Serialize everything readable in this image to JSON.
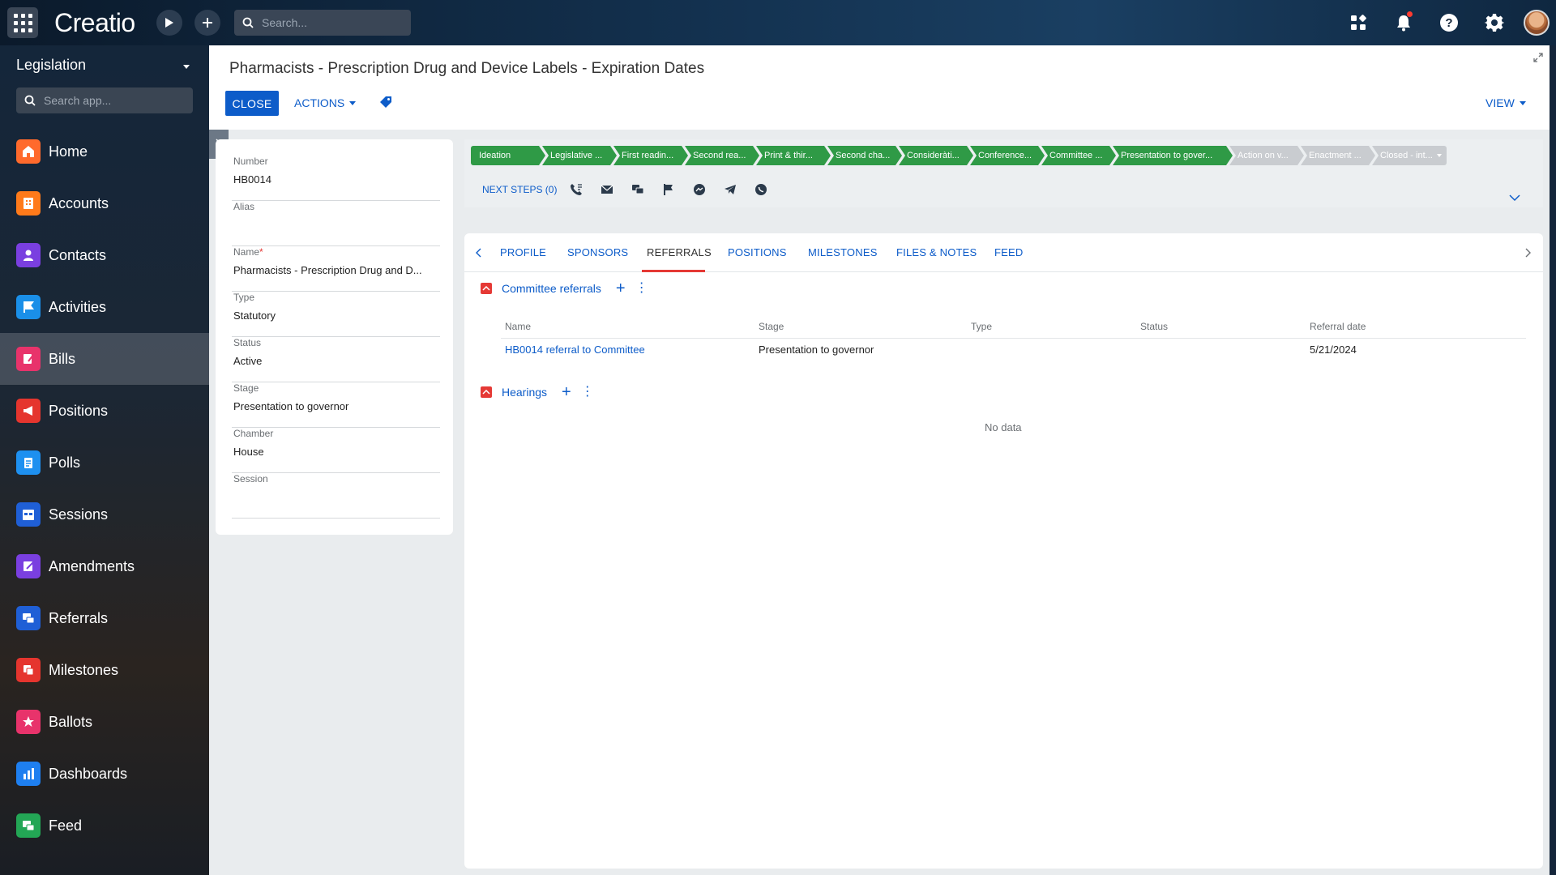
{
  "topbar": {
    "logo": "Creatio",
    "search_placeholder": "Search..."
  },
  "sidebar": {
    "title": "Legislation",
    "search_placeholder": "Search app...",
    "items": [
      {
        "label": "Home",
        "color": "#ff6a2c"
      },
      {
        "label": "Accounts",
        "color": "#ff7a1a"
      },
      {
        "label": "Contacts",
        "color": "#7a3fe0"
      },
      {
        "label": "Activities",
        "color": "#1a8fe8"
      },
      {
        "label": "Bills",
        "color": "#e8336b"
      },
      {
        "label": "Positions",
        "color": "#e5352e"
      },
      {
        "label": "Polls",
        "color": "#1e90f0"
      },
      {
        "label": "Sessions",
        "color": "#1f5fd6"
      },
      {
        "label": "Amendments",
        "color": "#7a3fe0"
      },
      {
        "label": "Referrals",
        "color": "#1f5fd6"
      },
      {
        "label": "Milestones",
        "color": "#e5352e"
      },
      {
        "label": "Ballots",
        "color": "#e8336b"
      },
      {
        "label": "Dashboards",
        "color": "#1e7ff0"
      },
      {
        "label": "Feed",
        "color": "#23a655"
      }
    ]
  },
  "header": {
    "title": "Pharmacists - Prescription Drug and Device Labels - Expiration Dates",
    "close_label": "CLOSE",
    "actions_label": "ACTIONS",
    "view_label": "VIEW"
  },
  "form": {
    "number_label": "Number",
    "number_value": "HB0014",
    "alias_label": "Alias",
    "alias_value": "",
    "name_label": "Name",
    "name_required": "*",
    "name_value": "Pharmacists - Prescription Drug and D...",
    "type_label": "Type",
    "type_value": "Statutory",
    "status_label": "Status",
    "status_value": "Active",
    "stage_label": "Stage",
    "stage_value": "Presentation to governor",
    "chamber_label": "Chamber",
    "chamber_value": "House",
    "session_label": "Session",
    "session_value": ""
  },
  "stages": [
    {
      "label": "Ideation",
      "done": true
    },
    {
      "label": "Legislative ...",
      "done": true
    },
    {
      "label": "First readin...",
      "done": true
    },
    {
      "label": "Second rea...",
      "done": true
    },
    {
      "label": "Print & thir...",
      "done": true
    },
    {
      "label": "Second cha...",
      "done": true
    },
    {
      "label": "Consideràti...",
      "done": true
    },
    {
      "label": "Conference...",
      "done": true
    },
    {
      "label": "Committee ...",
      "done": true
    },
    {
      "label": "Presentation to gover...",
      "done": true
    },
    {
      "label": "Action on v...",
      "done": false
    },
    {
      "label": "Enactment ...",
      "done": false
    },
    {
      "label": "Closed - int...",
      "done": false
    }
  ],
  "next_steps": "NEXT STEPS (0)",
  "tabs": {
    "profile": "PROFILE",
    "sponsors": "SPONSORS",
    "referrals": "REFERRALS",
    "positions": "POSITIONS",
    "milestones": "MILESTONES",
    "files_notes": "FILES & NOTES",
    "feed": "FEED"
  },
  "committee_referrals": {
    "title": "Committee referrals",
    "columns": {
      "name": "Name",
      "stage": "Stage",
      "type": "Type",
      "status": "Status",
      "referral_date": "Referral date"
    },
    "rows": [
      {
        "name": "HB0014 referral to Committee",
        "stage": "Presentation to governor",
        "type": "",
        "status": "",
        "referral_date": "5/21/2024"
      }
    ]
  },
  "hearings": {
    "title": "Hearings",
    "empty": "No data"
  }
}
